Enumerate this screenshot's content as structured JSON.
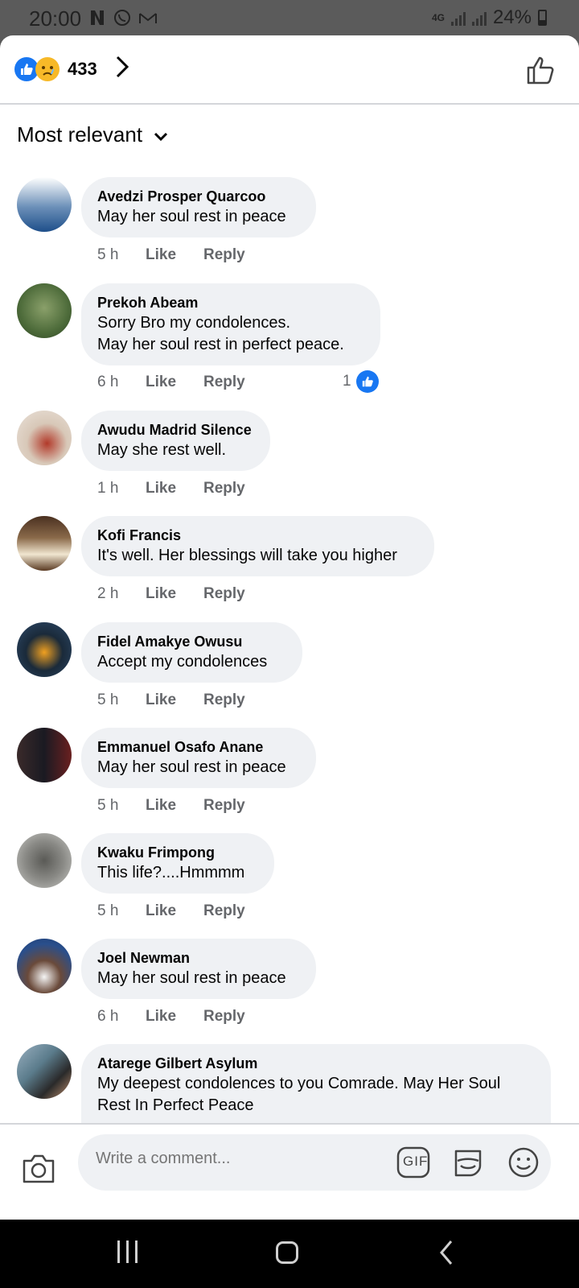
{
  "status_bar": {
    "time": "20:00",
    "network": "4G",
    "battery": "24%"
  },
  "header": {
    "reaction_count": "433",
    "reaction_icons": [
      "like-icon",
      "sad-icon"
    ]
  },
  "sort": {
    "label": "Most relevant"
  },
  "comments": [
    {
      "name": "Avedzi Prosper Quarcoo",
      "text": "May her soul rest in peace",
      "time": "5 h",
      "like": "Like",
      "reply": "Reply",
      "avatar_color": "#6b8fb8"
    },
    {
      "name": "Prekoh Abeam",
      "text": "Sorry Bro my condolences.\nMay her soul rest in perfect peace.",
      "time": "6 h",
      "like": "Like",
      "reply": "Reply",
      "reactions": "1",
      "avatar_color": "#4d6b3a"
    },
    {
      "name": "Awudu Madrid Silence",
      "text": "May she rest well.",
      "time": "1 h",
      "like": "Like",
      "reply": "Reply",
      "avatar_color": "#c9b8a8"
    },
    {
      "name": "Kofi Francis",
      "text": "It's well. Her blessings will take you higher",
      "time": "2 h",
      "like": "Like",
      "reply": "Reply",
      "avatar_color": "#6e4a2e"
    },
    {
      "name": "Fidel Amakye Owusu",
      "text": "Accept my condolences",
      "time": "5 h",
      "like": "Like",
      "reply": "Reply",
      "avatar_color": "#2e4a6a"
    },
    {
      "name": "Emmanuel Osafo Anane",
      "text": "May her soul rest in peace",
      "time": "5 h",
      "like": "Like",
      "reply": "Reply",
      "avatar_color": "#3a2a2a"
    },
    {
      "name": "Kwaku Frimpong",
      "text": "This life?....Hmmmm",
      "time": "5 h",
      "like": "Like",
      "reply": "Reply",
      "avatar_color": "#8a8a86"
    },
    {
      "name": "Joel Newman",
      "text": "May her soul rest in peace",
      "time": "6 h",
      "like": "Like",
      "reply": "Reply",
      "avatar_color": "#2a4f8c"
    },
    {
      "name": "Ataregе Gilbert Asylum",
      "text": "My deepest condolences to you Comrade. May Her Soul Rest In Perfect Peace",
      "avatar_color": "#5b7c8c"
    }
  ],
  "composer": {
    "placeholder": "Write a comment...",
    "gif_label": "GIF"
  }
}
